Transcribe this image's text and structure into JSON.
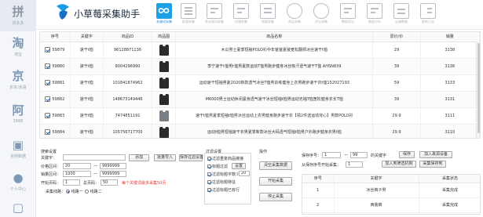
{
  "app": {
    "title": "小草莓采集助手"
  },
  "sidebar": {
    "items": [
      {
        "label": "拼多多",
        "icon": "pdd-icon",
        "glyph": "拼"
      },
      {
        "label": "淘宝",
        "icon": "taobao-icon",
        "glyph": "淘"
      },
      {
        "label": "京东/京喜",
        "icon": "jd-icon",
        "glyph": "京"
      },
      {
        "label": "1688",
        "icon": "alibaba-icon",
        "glyph": "阿"
      },
      {
        "label": "全网数据",
        "icon": "chart-icon",
        "glyph": "▣"
      },
      {
        "label": "个人中心",
        "icon": "user-icon",
        "glyph": "●"
      },
      {
        "label": "",
        "icon": "device-icon",
        "glyph": "▢"
      }
    ]
  },
  "toolbar": {
    "items": [
      {
        "label": "关键词采集",
        "icon": "infinity-icon"
      },
      {
        "label": "批量采集",
        "icon": "list-icon"
      },
      {
        "label": "多关键词采集",
        "icon": "doc-search-icon"
      },
      {
        "label": "店铺采集",
        "icon": "doc-search-icon"
      },
      {
        "label": "销量采集",
        "icon": "shop-icon"
      },
      {
        "label": "商品采集",
        "icon": "people-icon"
      },
      {
        "label": "评论采集",
        "icon": "people-icon"
      },
      {
        "label": "数据导出",
        "icon": "doc-search-icon"
      },
      {
        "label": "数据分析",
        "icon": "doc-search-icon"
      },
      {
        "label": "云端数据",
        "icon": "grid-icon"
      },
      {
        "label": "更新日志",
        "icon": "checklist-icon"
      }
    ]
  },
  "table": {
    "columns": [
      "序号",
      "关键字",
      "商品ID",
      "商品图",
      "商品名称",
      "原价/价",
      "销量"
    ],
    "rows": [
      {
        "seq": "59879",
        "keyword": "速干t恤",
        "id": "96128871136",
        "name": "木瓜男士夏季短袖POLO衫中年爸爸夏装宽松翻领冰丝速干t恤",
        "price": "29",
        "sales": "3138",
        "img": "dark"
      },
      {
        "seq": "59880",
        "keyword": "速干t恤",
        "id": "8004296990",
        "name": "李宁速干t恤男t恤男夏款运动T恤男跑步健身冰丝吸汗透气速干T恤 AHSN839",
        "price": "39",
        "sales": "3136",
        "img": "dark"
      },
      {
        "seq": "59881",
        "keyword": "速干t恤",
        "id": "101841874962",
        "name": "运动速干短袖男夏2020新款透气冰丝T恤男训练健身上衣男跑步速干衣t恤152027193",
        "price": "59",
        "sales": "3133",
        "img": "dark"
      },
      {
        "seq": "59882",
        "keyword": "速干t恤",
        "id": "148673149446",
        "name": "M6000男士运动休闲紧身透气速干冰丝短袖t恤男运动无袖T恤宽松健身衣长T恤",
        "price": "39",
        "sales": "3131",
        "img": "dark"
      },
      {
        "seq": "59883",
        "keyword": "速干t恤",
        "id": "7474851191",
        "name": "速干t恤男夏季短袖t恤男冰丝运动上衣男健身跑步速干衣【领2件送运动背心】男款POLO衫",
        "price": "29.9",
        "sales": "3111",
        "img": "grey"
      },
      {
        "seq": "59884",
        "keyword": "速干t恤",
        "id": "105756717700",
        "name": "运动t恤男短袖速干衣男夏季新款冰丝大码透气短袖t恤男户外跑步健身衣男t恤",
        "price": "29.9",
        "sales": "3110",
        "img": "dark"
      }
    ]
  },
  "search_settings": {
    "title": "搜索设置",
    "keyword_label": "关键字：",
    "keyword_value": "",
    "add_button": "添加",
    "batch_import_button": "批量导入",
    "save_filter_button": "保存过滤设置",
    "price_label": "价格区间：",
    "price_min": "20",
    "price_max": "9999999",
    "sales_label": "销量区间：",
    "sales_min": "1000",
    "sales_max": "9999999",
    "start_page_label": "开始页码：",
    "start_page": "1",
    "total_pages_label": "总页码：",
    "total_pages": "50",
    "page_hint": "每个关键词最多采集50页",
    "interface_label": "采集线路：",
    "radio_1": "线路一",
    "radio_2": "线路二"
  },
  "filter_settings": {
    "title": "过滤设置",
    "items": [
      {
        "label": "过滤重复商品链接",
        "checked": true
      },
      {
        "label": "标题过滤",
        "checked": true,
        "button": "设置"
      },
      {
        "label": "过滤标题字数少于",
        "checked": true,
        "value": "20"
      },
      {
        "label": "过滤标题特征",
        "checked": true
      },
      {
        "label": "过滤标题已有行",
        "checked": true
      }
    ]
  },
  "operations": {
    "title": "操作",
    "clear_button": "清空采集数据",
    "start_button": "开始采集",
    "stop_button": "停止采集"
  },
  "save_range": {
    "label": "保存序号：",
    "from": "1",
    "dash": "—",
    "to": "99",
    "suffix": "的关键字",
    "save_button": "保存",
    "add_to_cloud_button": "加入来源设备",
    "from_label": "从保存序号开始采集：",
    "from_value": "1",
    "add_product_button": "加入到筛选机制",
    "export_button": "采集保存到"
  },
  "keyword_table": {
    "columns": [
      "序号",
      "关键字",
      "采集状态"
    ],
    "rows": [
      {
        "seq": "1",
        "keyword": "冰丝裤子男",
        "status": "采集完成"
      },
      {
        "seq": "2",
        "keyword": "西装裤",
        "status": "采集完成"
      }
    ]
  }
}
